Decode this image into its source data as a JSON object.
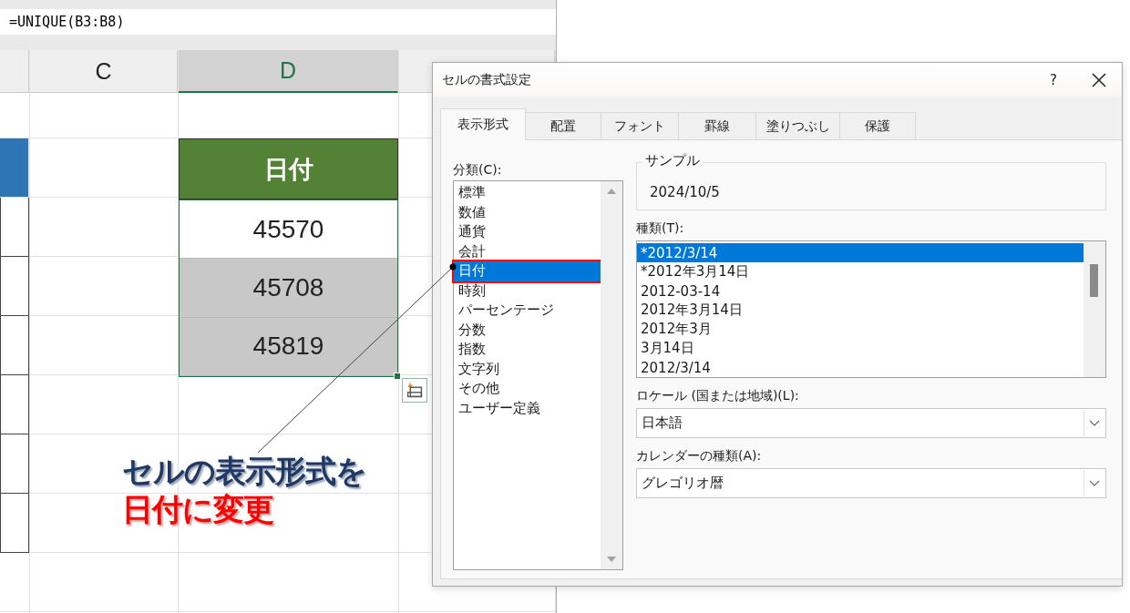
{
  "formula_bar": {
    "formula": "=UNIQUE(B3:B8)"
  },
  "sheet": {
    "columns": [
      {
        "label": "C",
        "selected": false
      },
      {
        "label": "D",
        "selected": true
      }
    ],
    "header_cell": "日付",
    "values": [
      {
        "text": "45570",
        "active": true
      },
      {
        "text": "45708",
        "active": false
      },
      {
        "text": "45819",
        "active": false
      }
    ]
  },
  "callout": {
    "line_1": "セルの表示形式を",
    "line_2": "日付に変更"
  },
  "dialog": {
    "title": "セルの書式設定",
    "help": "?",
    "tabs": [
      {
        "label": "表示形式",
        "selected": true
      },
      {
        "label": "配置",
        "selected": false
      },
      {
        "label": "フォント",
        "selected": false
      },
      {
        "label": "罫線",
        "selected": false
      },
      {
        "label": "塗りつぶし",
        "selected": false
      },
      {
        "label": "保護",
        "selected": false
      }
    ],
    "category_label": "分類(C):",
    "categories": [
      {
        "label": "標準",
        "selected": false,
        "highlighted": false
      },
      {
        "label": "数値",
        "selected": false,
        "highlighted": false
      },
      {
        "label": "通貨",
        "selected": false,
        "highlighted": false
      },
      {
        "label": "会計",
        "selected": false,
        "highlighted": false
      },
      {
        "label": "日付",
        "selected": true,
        "highlighted": true
      },
      {
        "label": "時刻",
        "selected": false,
        "highlighted": false
      },
      {
        "label": "パーセンテージ",
        "selected": false,
        "highlighted": false
      },
      {
        "label": "分数",
        "selected": false,
        "highlighted": false
      },
      {
        "label": "指数",
        "selected": false,
        "highlighted": false
      },
      {
        "label": "文字列",
        "selected": false,
        "highlighted": false
      },
      {
        "label": "その他",
        "selected": false,
        "highlighted": false
      },
      {
        "label": "ユーザー定義",
        "selected": false,
        "highlighted": false
      }
    ],
    "sample": {
      "label": "サンプル",
      "value": "2024/10/5"
    },
    "type_label": "種類(T):",
    "types": [
      {
        "label": "*2012/3/14",
        "selected": true
      },
      {
        "label": "*2012年3月14日",
        "selected": false
      },
      {
        "label": "2012-03-14",
        "selected": false
      },
      {
        "label": "2012年3月14日",
        "selected": false
      },
      {
        "label": "2012年3月",
        "selected": false
      },
      {
        "label": "3月14日",
        "selected": false
      },
      {
        "label": "2012/3/14",
        "selected": false
      }
    ],
    "locale": {
      "label": "ロケール (国または地域)(L):",
      "value": "日本語"
    },
    "calendar": {
      "label": "カレンダーの種類(A):",
      "value": "グレゴリオ暦"
    }
  }
}
